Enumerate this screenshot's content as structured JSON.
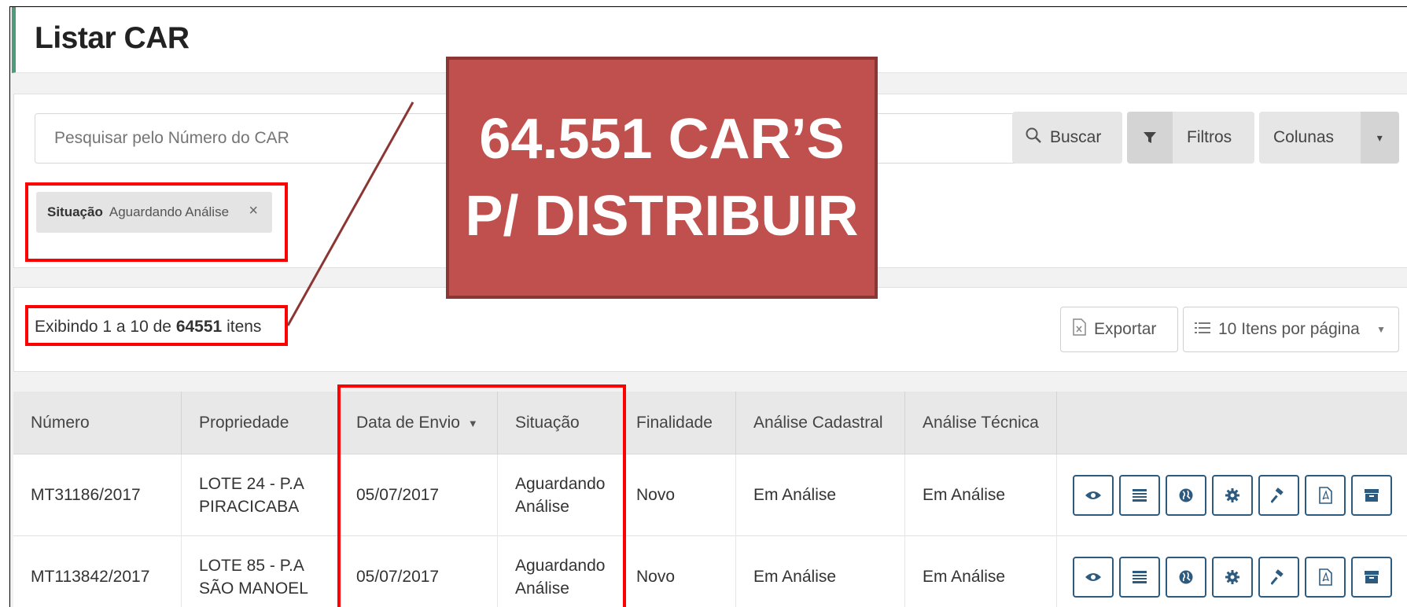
{
  "page": {
    "title": "Listar CAR"
  },
  "search": {
    "placeholder": "Pesquisar pelo Número do CAR",
    "buscar_label": "Buscar",
    "filtros_label": "Filtros",
    "colunas_label": "Colunas"
  },
  "filter_chip": {
    "key": "Situação",
    "value": "Aguardando Análise",
    "remove": "×"
  },
  "results": {
    "prefix": "Exibindo 1 a 10 de",
    "total": "64551",
    "suffix": "itens",
    "export_label": "Exportar",
    "per_page_label": "10 Itens por página"
  },
  "table": {
    "headers": [
      "Número",
      "Propriedade",
      "Data de Envio",
      "Situação",
      "Finalidade",
      "Análise Cadastral",
      "Análise Técnica"
    ],
    "sort_indicator": "▼",
    "rows": [
      {
        "numero": "MT31186/2017",
        "propriedade_1": "LOTE 24 - P.A",
        "propriedade_2": "PIRACICABA",
        "data": "05/07/2017",
        "situacao_1": "Aguardando",
        "situacao_2": "Análise",
        "finalidade": "Novo",
        "cadastral": "Em Análise",
        "tecnica": "Em Análise"
      },
      {
        "numero": "MT113842/2017",
        "propriedade_1": "LOTE 85 - P.A",
        "propriedade_2": "SÃO MANOEL",
        "data": "05/07/2017",
        "situacao_1": "Aguardando",
        "situacao_2": "Análise",
        "finalidade": "Novo",
        "cadastral": "Em Análise",
        "tecnica": "Em Análise"
      }
    ],
    "action_icons": [
      "eye-icon",
      "list-icon",
      "globe-icon",
      "gear-icon",
      "gavel-icon",
      "pdf-icon",
      "archive-icon"
    ]
  },
  "callout": {
    "line1": "64.551 CAR’S",
    "line2": "P/ DISTRIBUIR"
  },
  "colors": {
    "accent": "#4e9a7a",
    "callout_bg": "#c0504d",
    "highlight": "#ff0000",
    "action_border": "#2d5b80"
  }
}
